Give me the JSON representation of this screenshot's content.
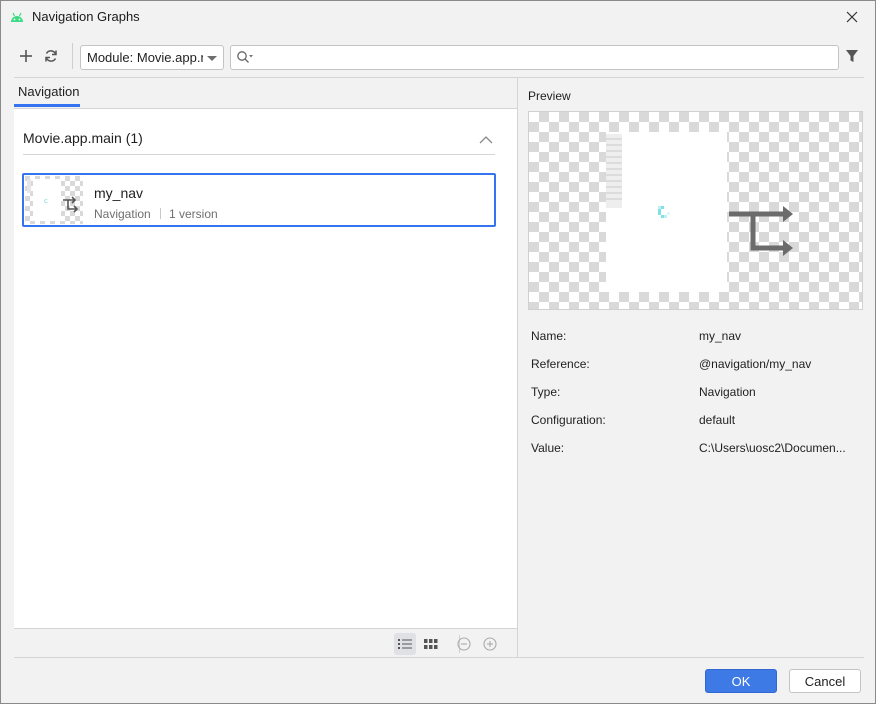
{
  "window": {
    "title": "Navigation Graphs",
    "app_icon": "android-icon",
    "close_icon": "close-icon"
  },
  "toolbar": {
    "add_icon": "plus-icon",
    "refresh_icon": "refresh-icon",
    "module_select": "Module: Movie.app.main",
    "search_value": "",
    "search_icon": "search-icon",
    "filter_icon": "filter-icon"
  },
  "left": {
    "tab_label": "Navigation",
    "group": {
      "title": "Movie.app.main",
      "count": "(1)",
      "expanded": true
    },
    "items": [
      {
        "name": "my_nav",
        "type": "Navigation",
        "version": "1 version"
      }
    ],
    "view_mode": "list"
  },
  "preview": {
    "label": "Preview",
    "properties": [
      {
        "key": "Name:",
        "value": "my_nav"
      },
      {
        "key": "Reference:",
        "value": "@navigation/my_nav"
      },
      {
        "key": "Type:",
        "value": "Navigation"
      },
      {
        "key": "Configuration:",
        "value": "default"
      },
      {
        "key": "Value:",
        "value": "C:\\Users\\uosc2\\Documen..."
      }
    ]
  },
  "buttons": {
    "ok": "OK",
    "cancel": "Cancel"
  },
  "colors": {
    "accent": "#3574f0",
    "ok_button": "#3d7ae6",
    "background": "#f2f2f2",
    "panel": "#ffffff"
  }
}
